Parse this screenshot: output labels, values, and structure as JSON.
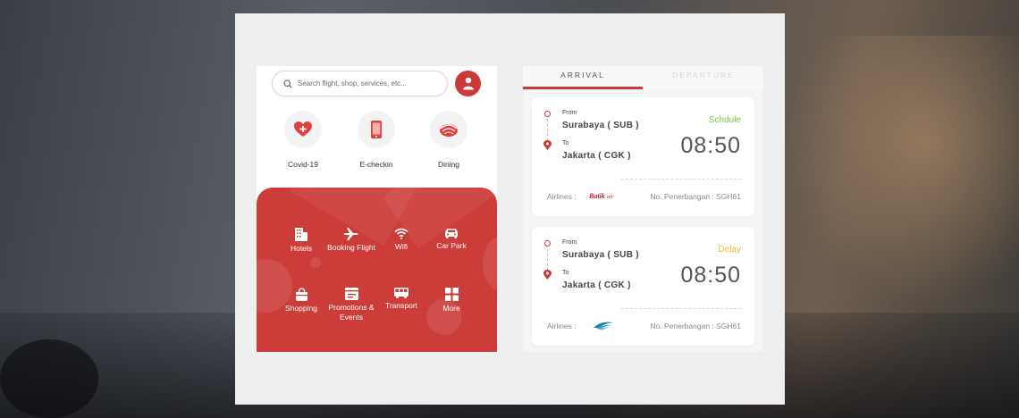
{
  "search": {
    "placeholder": "Search flight, shop, services, etc..."
  },
  "quick_actions": [
    {
      "label": "Covid-19",
      "icon": "heart-plus-icon"
    },
    {
      "label": "E-checkin",
      "icon": "phone-icon"
    },
    {
      "label": "Dining",
      "icon": "sushi-icon"
    }
  ],
  "services": [
    {
      "label": "Hotels",
      "icon": "building-icon"
    },
    {
      "label": "Booking Flight",
      "icon": "airplane-icon"
    },
    {
      "label": "Wifi",
      "icon": "wifi-icon"
    },
    {
      "label": "Car Park",
      "icon": "car-icon"
    },
    {
      "label": "Shopping",
      "icon": "shopping-bag-icon"
    },
    {
      "label": "Promotions & Events",
      "icon": "promo-icon"
    },
    {
      "label": "Transport",
      "icon": "bus-icon"
    },
    {
      "label": "More",
      "icon": "grid-icon"
    }
  ],
  "tabs": {
    "arrival": "ARRIVAL",
    "departure": "DEPARTURE"
  },
  "flights": [
    {
      "from_label": "From",
      "from": "Surabaya ( SUB )",
      "to_label": "To",
      "to": "Jakarta ( CGK )",
      "status": "Schdule",
      "time": "08:50",
      "airlines_label": "Airlines :",
      "airline_logo": "Batik Air",
      "flight_no": "No. Penerbangan : SGH61"
    },
    {
      "from_label": "From",
      "from": "Surabaya ( SUB )",
      "to_label": "To",
      "to": "Jakarta ( CGK )",
      "status": "Delay",
      "time": "08:50",
      "airlines_label": "Airlines :",
      "airline_logo": "Garuda Indonesia",
      "flight_no": "No. Penerbangan : SGH61"
    }
  ],
  "colors": {
    "accent": "#cc3a37",
    "schedule": "#7ac943",
    "delay": "#f5b82e"
  }
}
